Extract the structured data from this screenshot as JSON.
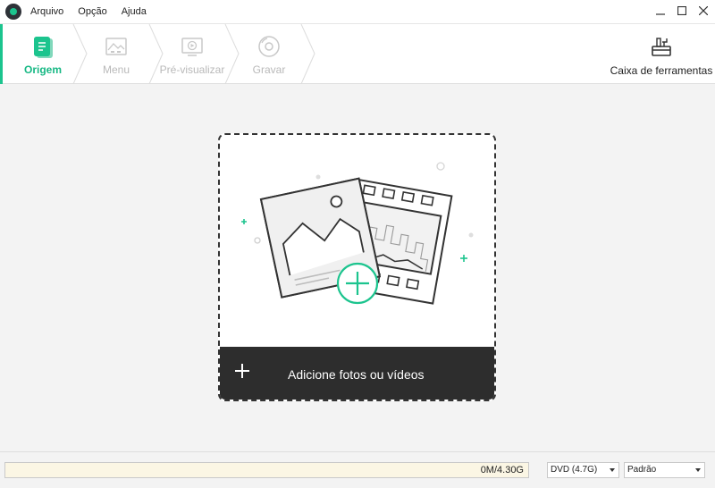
{
  "menu": {
    "items": [
      "Arquivo",
      "Opção",
      "Ajuda"
    ]
  },
  "window_controls": [
    "minimize-icon",
    "maximize-icon",
    "close-icon"
  ],
  "steps": [
    {
      "label": "Origem",
      "icon": "document-icon",
      "active": true
    },
    {
      "label": "Menu",
      "icon": "image-menu-icon",
      "active": false
    },
    {
      "label": "Pré-visualizar",
      "icon": "play-screen-icon",
      "active": false
    },
    {
      "label": "Gravar",
      "icon": "disc-icon",
      "active": false
    }
  ],
  "toolbox": {
    "label": "Caixa de ferramentas",
    "icon": "toolbox-icon"
  },
  "drop_card": {
    "label": "Adicione fotos ou vídeos",
    "icon": "plus-icon"
  },
  "status": {
    "capacity_text": "0M/4.30G",
    "disc_select": "DVD (4.7G)",
    "quality_select": "Padrão"
  },
  "colors": {
    "accent": "#1cc48e",
    "card_bottom": "#2d2d2d",
    "capacity_bg": "#fbf6e4"
  }
}
